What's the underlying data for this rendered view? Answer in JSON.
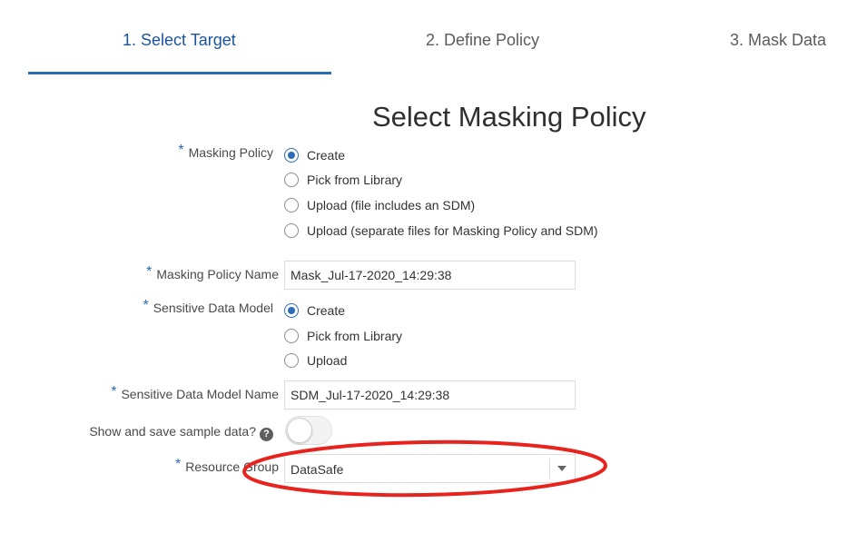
{
  "steps": [
    {
      "label": "1. Select Target",
      "active": true
    },
    {
      "label": "2. Define Policy",
      "active": false
    },
    {
      "label": "3. Mask Data",
      "active": false
    }
  ],
  "title": "Select Masking Policy",
  "required_marker": "*",
  "masking_policy": {
    "label": "Masking Policy",
    "options": [
      {
        "label": "Create",
        "checked": true
      },
      {
        "label": "Pick from Library",
        "checked": false
      },
      {
        "label": "Upload (file includes an SDM)",
        "checked": false
      },
      {
        "label": "Upload (separate files for Masking Policy and SDM)",
        "checked": false
      }
    ]
  },
  "masking_policy_name": {
    "label": "Masking Policy Name",
    "value": "Mask_Jul-17-2020_14:29:38"
  },
  "sensitive_data_model": {
    "label": "Sensitive Data Model",
    "options": [
      {
        "label": "Create",
        "checked": true
      },
      {
        "label": "Pick from Library",
        "checked": false
      },
      {
        "label": "Upload",
        "checked": false
      }
    ]
  },
  "sensitive_data_model_name": {
    "label": "Sensitive Data Model Name",
    "value": "SDM_Jul-17-2020_14:29:38"
  },
  "sample_data": {
    "label": "Show and save sample data?",
    "help_icon": "?",
    "enabled": false
  },
  "resource_group": {
    "label": "Resource Group",
    "value": "DataSafe"
  },
  "colors": {
    "accent": "#2a6cb5",
    "active_step_text": "#19549c",
    "annotation": "#e8231d"
  }
}
